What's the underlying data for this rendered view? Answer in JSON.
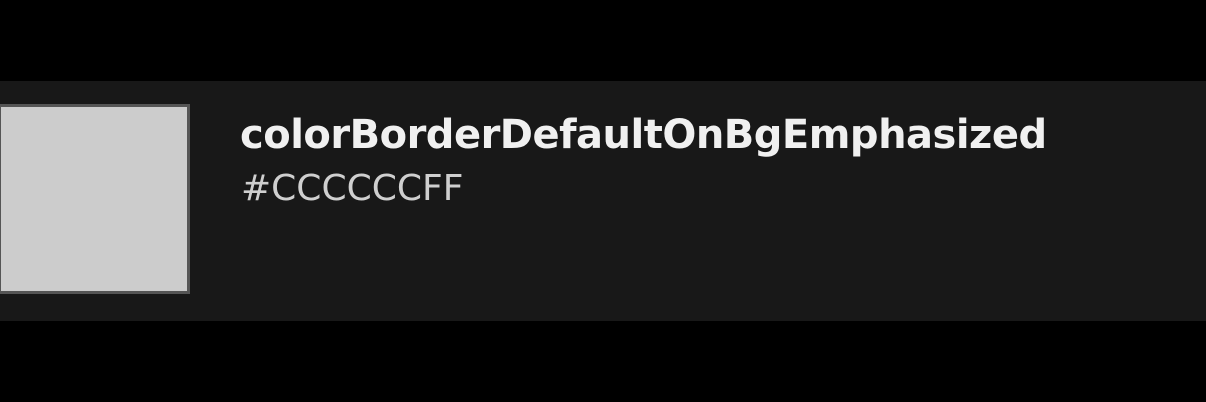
{
  "token": {
    "name": "colorBorderDefaultOnBgEmphasized",
    "value": "#CCCCCCFF",
    "swatch_color": "#CCCCCC",
    "swatch_border_color": "#555555"
  },
  "colors": {
    "page_background": "#000000",
    "row_background": "#181818",
    "name_text": "#F0F0F0",
    "value_text": "#CFCFCF"
  }
}
